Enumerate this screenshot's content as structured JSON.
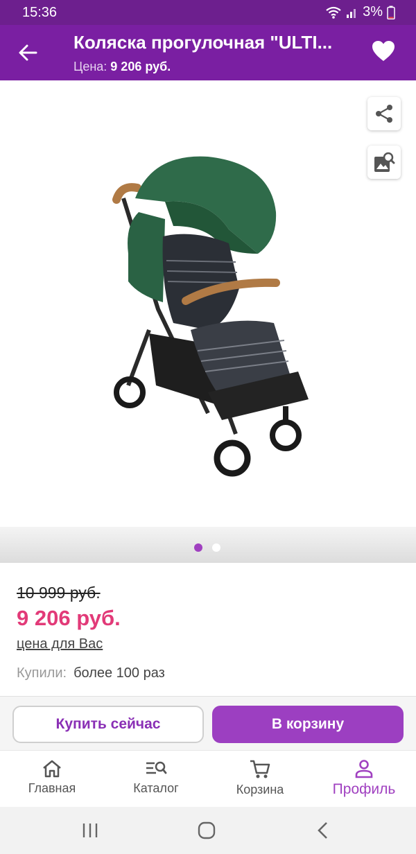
{
  "status_bar": {
    "time": "15:36",
    "battery": "3%"
  },
  "header": {
    "title": "Коляска прогулочная \"ULTI...",
    "price_label": "Цена:",
    "price_value": "9 206 руб."
  },
  "gallery": {
    "image_count": 2,
    "active_index": 0
  },
  "product": {
    "old_price": "10 999 руб.",
    "new_price": "9 206 руб.",
    "price_note": "цена для Вас",
    "bought_label": "Купили:",
    "bought_value": "более 100 раз"
  },
  "actions": {
    "buy_now": "Купить сейчас",
    "add_to_cart": "В корзину"
  },
  "bottom_nav": {
    "items": [
      {
        "label": "Главная",
        "icon": "home-icon"
      },
      {
        "label": "Каталог",
        "icon": "catalog-search-icon"
      },
      {
        "label": "Корзина",
        "icon": "cart-icon"
      },
      {
        "label": "Профиль",
        "icon": "profile-icon"
      }
    ],
    "active": "Профиль"
  },
  "colors": {
    "header": "#7a1fa2",
    "status_bar": "#6d1f8e",
    "accent": "#9c3fc1",
    "price": "#e23a78"
  }
}
